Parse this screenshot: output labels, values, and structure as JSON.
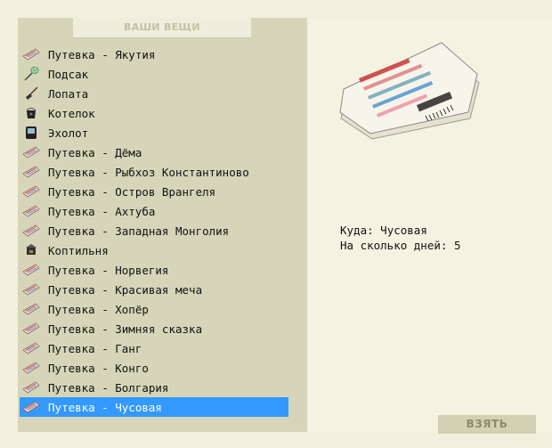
{
  "header": {
    "title": "ВАШИ ВЕЩИ"
  },
  "items": [
    {
      "label": "Путевка - Якутия",
      "icon": "ticket-icon"
    },
    {
      "label": "Подсак",
      "icon": "net-icon"
    },
    {
      "label": "Лопата",
      "icon": "shovel-icon"
    },
    {
      "label": "Котелок",
      "icon": "pot-icon"
    },
    {
      "label": "Эхолот",
      "icon": "sonar-icon"
    },
    {
      "label": "Путевка - Дёма",
      "icon": "ticket-icon"
    },
    {
      "label": "Путевка - Рыбхоз Константиново",
      "icon": "ticket-icon"
    },
    {
      "label": "Путевка - Остров Врангеля",
      "icon": "ticket-icon"
    },
    {
      "label": "Путевка - Ахтуба",
      "icon": "ticket-icon"
    },
    {
      "label": "Путевка - Западная Монголия",
      "icon": "ticket-icon"
    },
    {
      "label": "Коптильня",
      "icon": "smokehouse-icon"
    },
    {
      "label": "Путевка - Норвегия",
      "icon": "ticket-icon"
    },
    {
      "label": "Путевка - Красивая меча",
      "icon": "ticket-icon"
    },
    {
      "label": "Путевка - Хопёр",
      "icon": "ticket-icon"
    },
    {
      "label": "Путевка - Зимняя сказка",
      "icon": "ticket-icon"
    },
    {
      "label": "Путевка - Ганг",
      "icon": "ticket-icon"
    },
    {
      "label": "Путевка - Конго",
      "icon": "ticket-icon"
    },
    {
      "label": "Путевка - Болгария",
      "icon": "ticket-icon"
    },
    {
      "label": "Путевка - Чусовая",
      "icon": "ticket-icon",
      "selected": true
    }
  ],
  "details": {
    "destination_label": "Куда:",
    "destination_value": "Чусовая",
    "days_label": "На сколько дней:",
    "days_value": "5"
  },
  "actions": {
    "take_label": "ВЗЯТЬ"
  },
  "colors": {
    "selected": "#3399ff",
    "panel": "#d6d5b9",
    "background": "#f1f0de"
  }
}
